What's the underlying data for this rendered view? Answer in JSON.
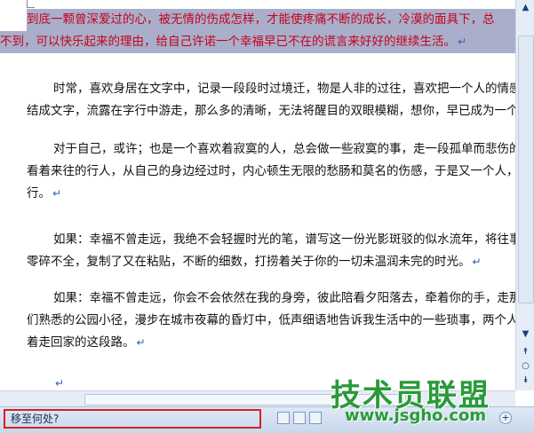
{
  "document": {
    "paragraphs": [
      {
        "selected": true,
        "lines": [
          "到底一颗曾深爱过的心，被无情的伤成怎样，才能使疼痛不断的成长，冷漠的面具下，总",
          "不到，可以快乐起来的理由，给自己许诺一个幸福早已不在的谎言来好好的继续生活。"
        ]
      },
      {
        "lines": [
          "时常，喜欢身居在文字中，记录一段段时过境迁，物是人非的过往，喜欢把一个人的情感",
          "结成文字，流露在字行中游走，那么多的清晰，无法将醒目的双眼模糊，想你，早已成为一个"
        ]
      },
      {
        "lines": [
          "对于自己，或许；也是一个喜欢着寂寞的人，总会做一些寂寞的事，走一段孤单而悲伤的街",
          "看着来往的行人，从自己的身边经过时，内心顿生无限的愁肠和莫名的伤感，于是又一个人，约",
          "行。"
        ]
      },
      {
        "lines": [
          "如果：幸福不曾走远，我绝不会轻握时光的笔，谱写这一份光影斑驳的似水流年，将往事",
          "零碎不全，复制了又在粘贴，不断的细数，打捞着关于你的一切未温润未完的时光。"
        ]
      },
      {
        "lines": [
          "如果：幸福不曾走远，你会不会依然在我的身旁，彼此陪看夕阳落去，牵着你的手，走那",
          "们熟悉的公园小径，漫步在城市夜幕的昏灯中，低声细语地告诉我生活中的一些琐事，两个人",
          "着走回家的这段路。"
        ]
      }
    ],
    "paragraph_mark": "↵"
  },
  "status_bar": {
    "prompt": "移至何处?"
  },
  "watermark": {
    "title": "技术员联盟",
    "url": "www.jsgho.com"
  },
  "icons": {
    "scroll_up": "▲",
    "scroll_down": "▼",
    "prev_page": "⯭",
    "browse_object": "○",
    "next_page": "⯯",
    "zoom_in": "+"
  }
}
